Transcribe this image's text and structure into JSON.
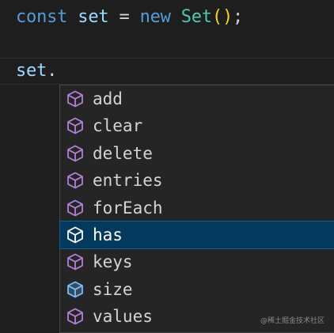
{
  "code": {
    "line1": {
      "kw_const": "const",
      "var_set": "set",
      "op_eq": "=",
      "kw_new": "new",
      "type_set": "Set",
      "paren_open": "(",
      "paren_close": ")",
      "semi": ";"
    },
    "line3": {
      "var_set": "set",
      "dot": "."
    }
  },
  "suggestions": {
    "items": [
      {
        "label": "add",
        "kind": "method-icon",
        "selected": false
      },
      {
        "label": "clear",
        "kind": "method-icon",
        "selected": false
      },
      {
        "label": "delete",
        "kind": "method-icon",
        "selected": false
      },
      {
        "label": "entries",
        "kind": "method-icon",
        "selected": false
      },
      {
        "label": "forEach",
        "kind": "method-icon",
        "selected": false
      },
      {
        "label": "has",
        "kind": "method-icon",
        "selected": true
      },
      {
        "label": "keys",
        "kind": "method-icon",
        "selected": false
      },
      {
        "label": "size",
        "kind": "property-icon",
        "selected": false
      },
      {
        "label": "values",
        "kind": "method-icon",
        "selected": false
      }
    ]
  },
  "watermark": {
    "text": "@稀土掘金技术社区"
  },
  "colors": {
    "method_icon": "#b180d7",
    "property_icon": "#75beff",
    "selected_bg": "#04395e"
  }
}
